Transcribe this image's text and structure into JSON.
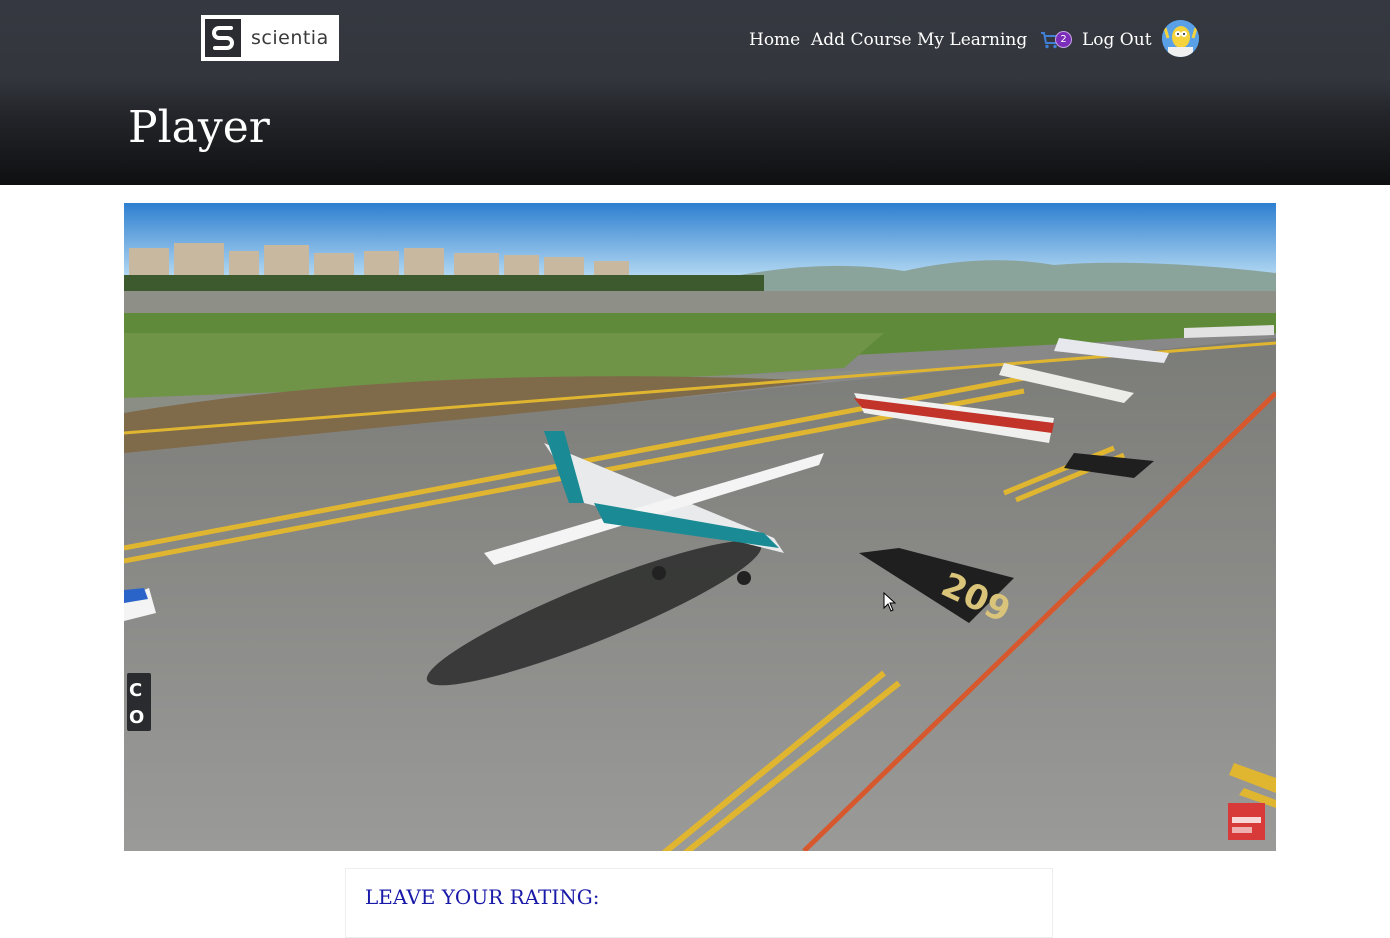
{
  "brand": {
    "name": "scientia",
    "logo_icon": "s-logo-icon"
  },
  "nav": {
    "home": "Home",
    "add_course": "Add Course",
    "my_learning": "My Learning",
    "cart_count": "2",
    "log_out": "Log Out"
  },
  "page": {
    "title": "Player"
  },
  "player": {
    "overlay_labels": [
      "C",
      "O"
    ],
    "watermark_icon": "channel-watermark-icon",
    "taxiway_marking": "209"
  },
  "rating": {
    "label": "LEAVE YOUR RATING:"
  },
  "colors": {
    "header_top": "#353840",
    "header_bottom": "#0e0f11",
    "cart_badge": "#7b2cb8",
    "rating_label": "#1a1aa8"
  }
}
